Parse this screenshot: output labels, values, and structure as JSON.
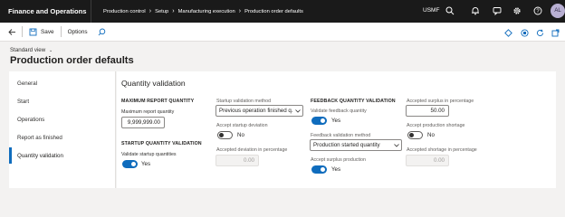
{
  "app_title": "Finance and Operations",
  "breadcrumbs": [
    "Production control",
    "Setup",
    "Manufacturing execution",
    "Production order defaults"
  ],
  "company": "USMF",
  "user_initials": "AL",
  "toolbar": {
    "save_label": "Save",
    "options_label": "Options"
  },
  "view_label": "Standard view",
  "page_title": "Production order defaults",
  "nav": {
    "items": [
      "General",
      "Start",
      "Operations",
      "Report as finished",
      "Quantity validation"
    ],
    "active": "Quantity validation"
  },
  "section_title": "Quantity validation",
  "max_report": {
    "group_title": "MAXIMUM REPORT QUANTITY",
    "field_label": "Maximum report quantity",
    "value": "9,999,999.00"
  },
  "startup_validation": {
    "group_title": "STARTUP QUANTITY VALIDATION",
    "toggle_label": "Validate startup quantities",
    "toggle_value": "Yes"
  },
  "startup_method": {
    "label": "Startup validation method",
    "value": "Previous operation finished q..."
  },
  "accept_startup_deviation": {
    "label": "Accept startup deviation",
    "value": "No"
  },
  "accepted_deviation": {
    "label": "Accepted deviation in percentage",
    "value": "0.00"
  },
  "feedback": {
    "group_title": "FEEDBACK QUANTITY VALIDATION",
    "toggle_label": "Validate feedback quantity",
    "toggle_value": "Yes",
    "method_label": "Feedback validation method",
    "method_value": "Production started quantity",
    "surplus_toggle_label": "Accept surplus production",
    "surplus_toggle_value": "Yes"
  },
  "accepted_surplus": {
    "label": "Accepted surplus in percentage",
    "value": "50.00"
  },
  "accept_shortage": {
    "label": "Accept production shortage",
    "value": "No"
  },
  "accepted_shortage": {
    "label": "Accepted shortage in percentage",
    "value": "0.00"
  },
  "colors": {
    "accent": "#0f6cbd",
    "topbar": "#1a1a1a",
    "background": "#f3f2f1"
  }
}
